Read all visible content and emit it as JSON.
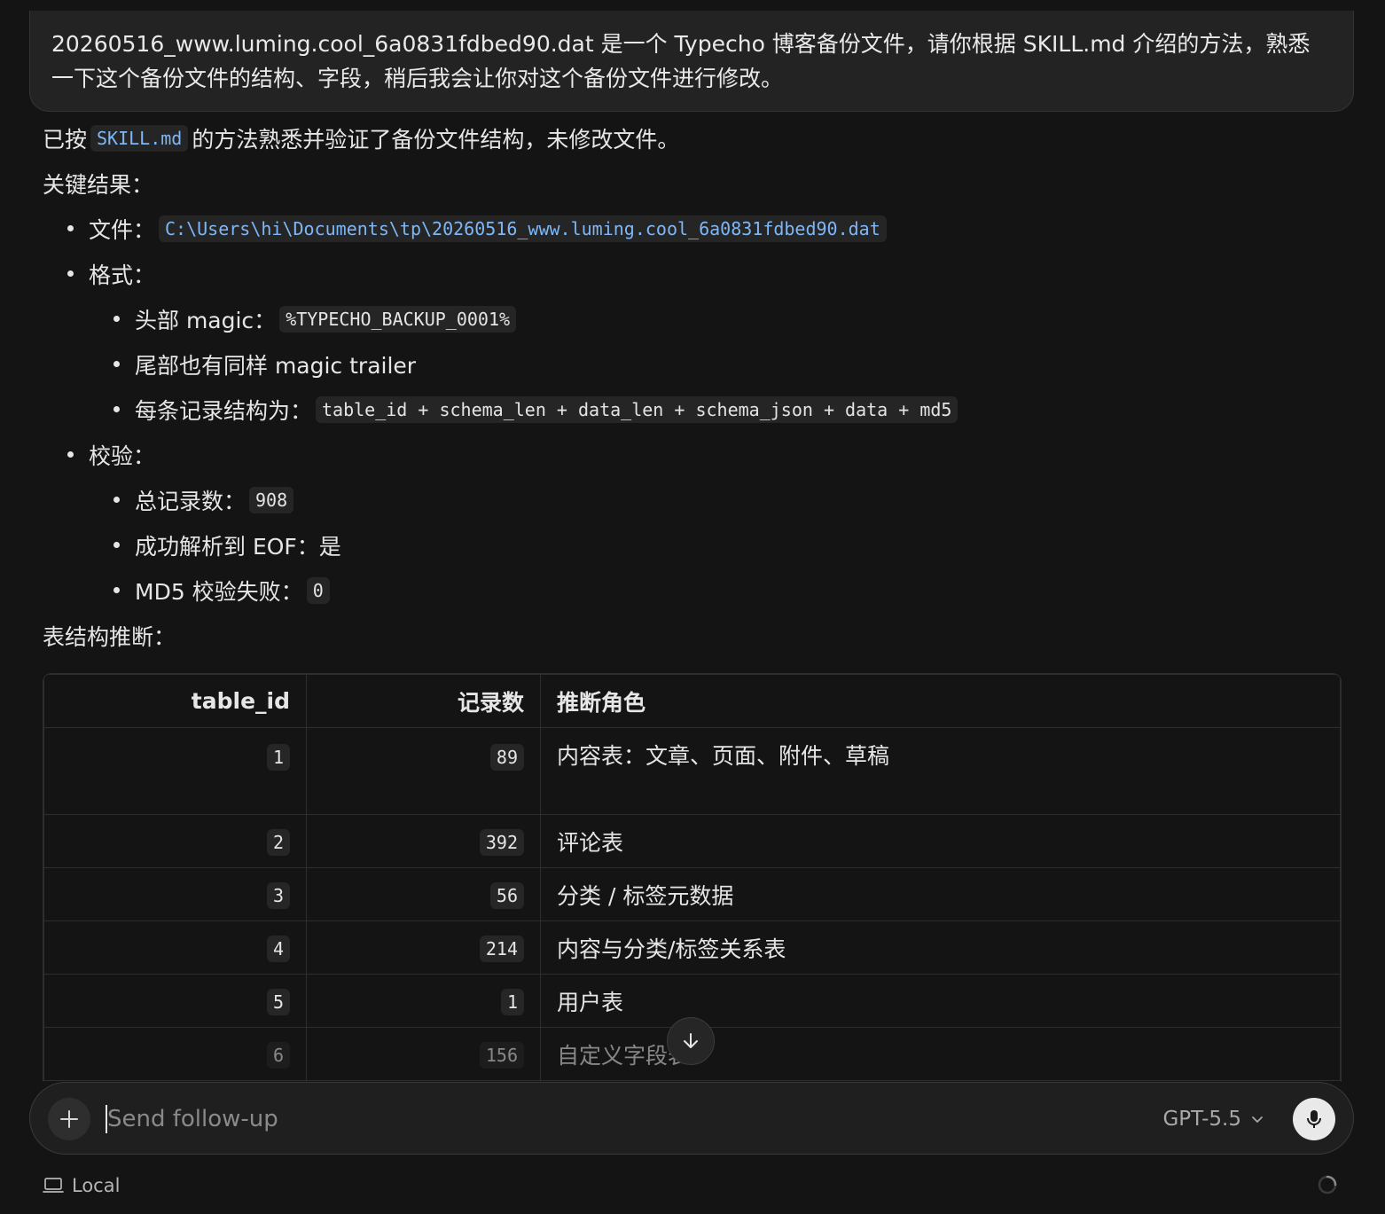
{
  "user_message": "20260516_www.luming.cool_6a0831fdbed90.dat 是一个 Typecho 博客备份文件，请你根据 SKILL.md 介绍的方法，熟悉一下这个备份文件的结构、字段，稍后我会让你对这个备份文件进行修改。",
  "reply": {
    "intro_prefix": "已按",
    "intro_code": "SKILL.md",
    "intro_suffix": "的方法熟悉并验证了备份文件结构，未修改文件。",
    "key_results_heading": "关键结果：",
    "file_label": "文件：",
    "file_path": "C:\\Users\\hi\\Documents\\tp\\20260516_www.luming.cool_6a0831fdbed90.dat",
    "format_label": "格式：",
    "magic_label": "头部 magic：",
    "magic_value": "%TYPECHO_BACKUP_0001%",
    "trailer_text": "尾部也有同样 magic trailer",
    "record_label": "每条记录结构为：",
    "record_value": "table_id + schema_len + data_len + schema_json + data + md5",
    "verify_label": "校验：",
    "total_label": "总记录数：",
    "total_value": "908",
    "eof_text": "成功解析到 EOF：是",
    "md5_label": "MD5 校验失败：",
    "md5_value": "0",
    "table_heading": "表结构推断："
  },
  "table": {
    "headers": [
      "table_id",
      "记录数",
      "推断角色"
    ],
    "rows": [
      {
        "id": "1",
        "count": "89",
        "role": "内容表：文章、页面、附件、草稿"
      },
      {
        "id": "2",
        "count": "392",
        "role": "评论表"
      },
      {
        "id": "3",
        "count": "56",
        "role": "分类 / 标签元数据"
      },
      {
        "id": "4",
        "count": "214",
        "role": "内容与分类/标签关系表"
      },
      {
        "id": "5",
        "count": "1",
        "role": "用户表"
      },
      {
        "id": "6",
        "count": "156",
        "role": "自定义字段表"
      }
    ]
  },
  "composer": {
    "placeholder": "Send follow-up",
    "model": "GPT-5.5"
  },
  "footer": {
    "env_label": "Local"
  }
}
